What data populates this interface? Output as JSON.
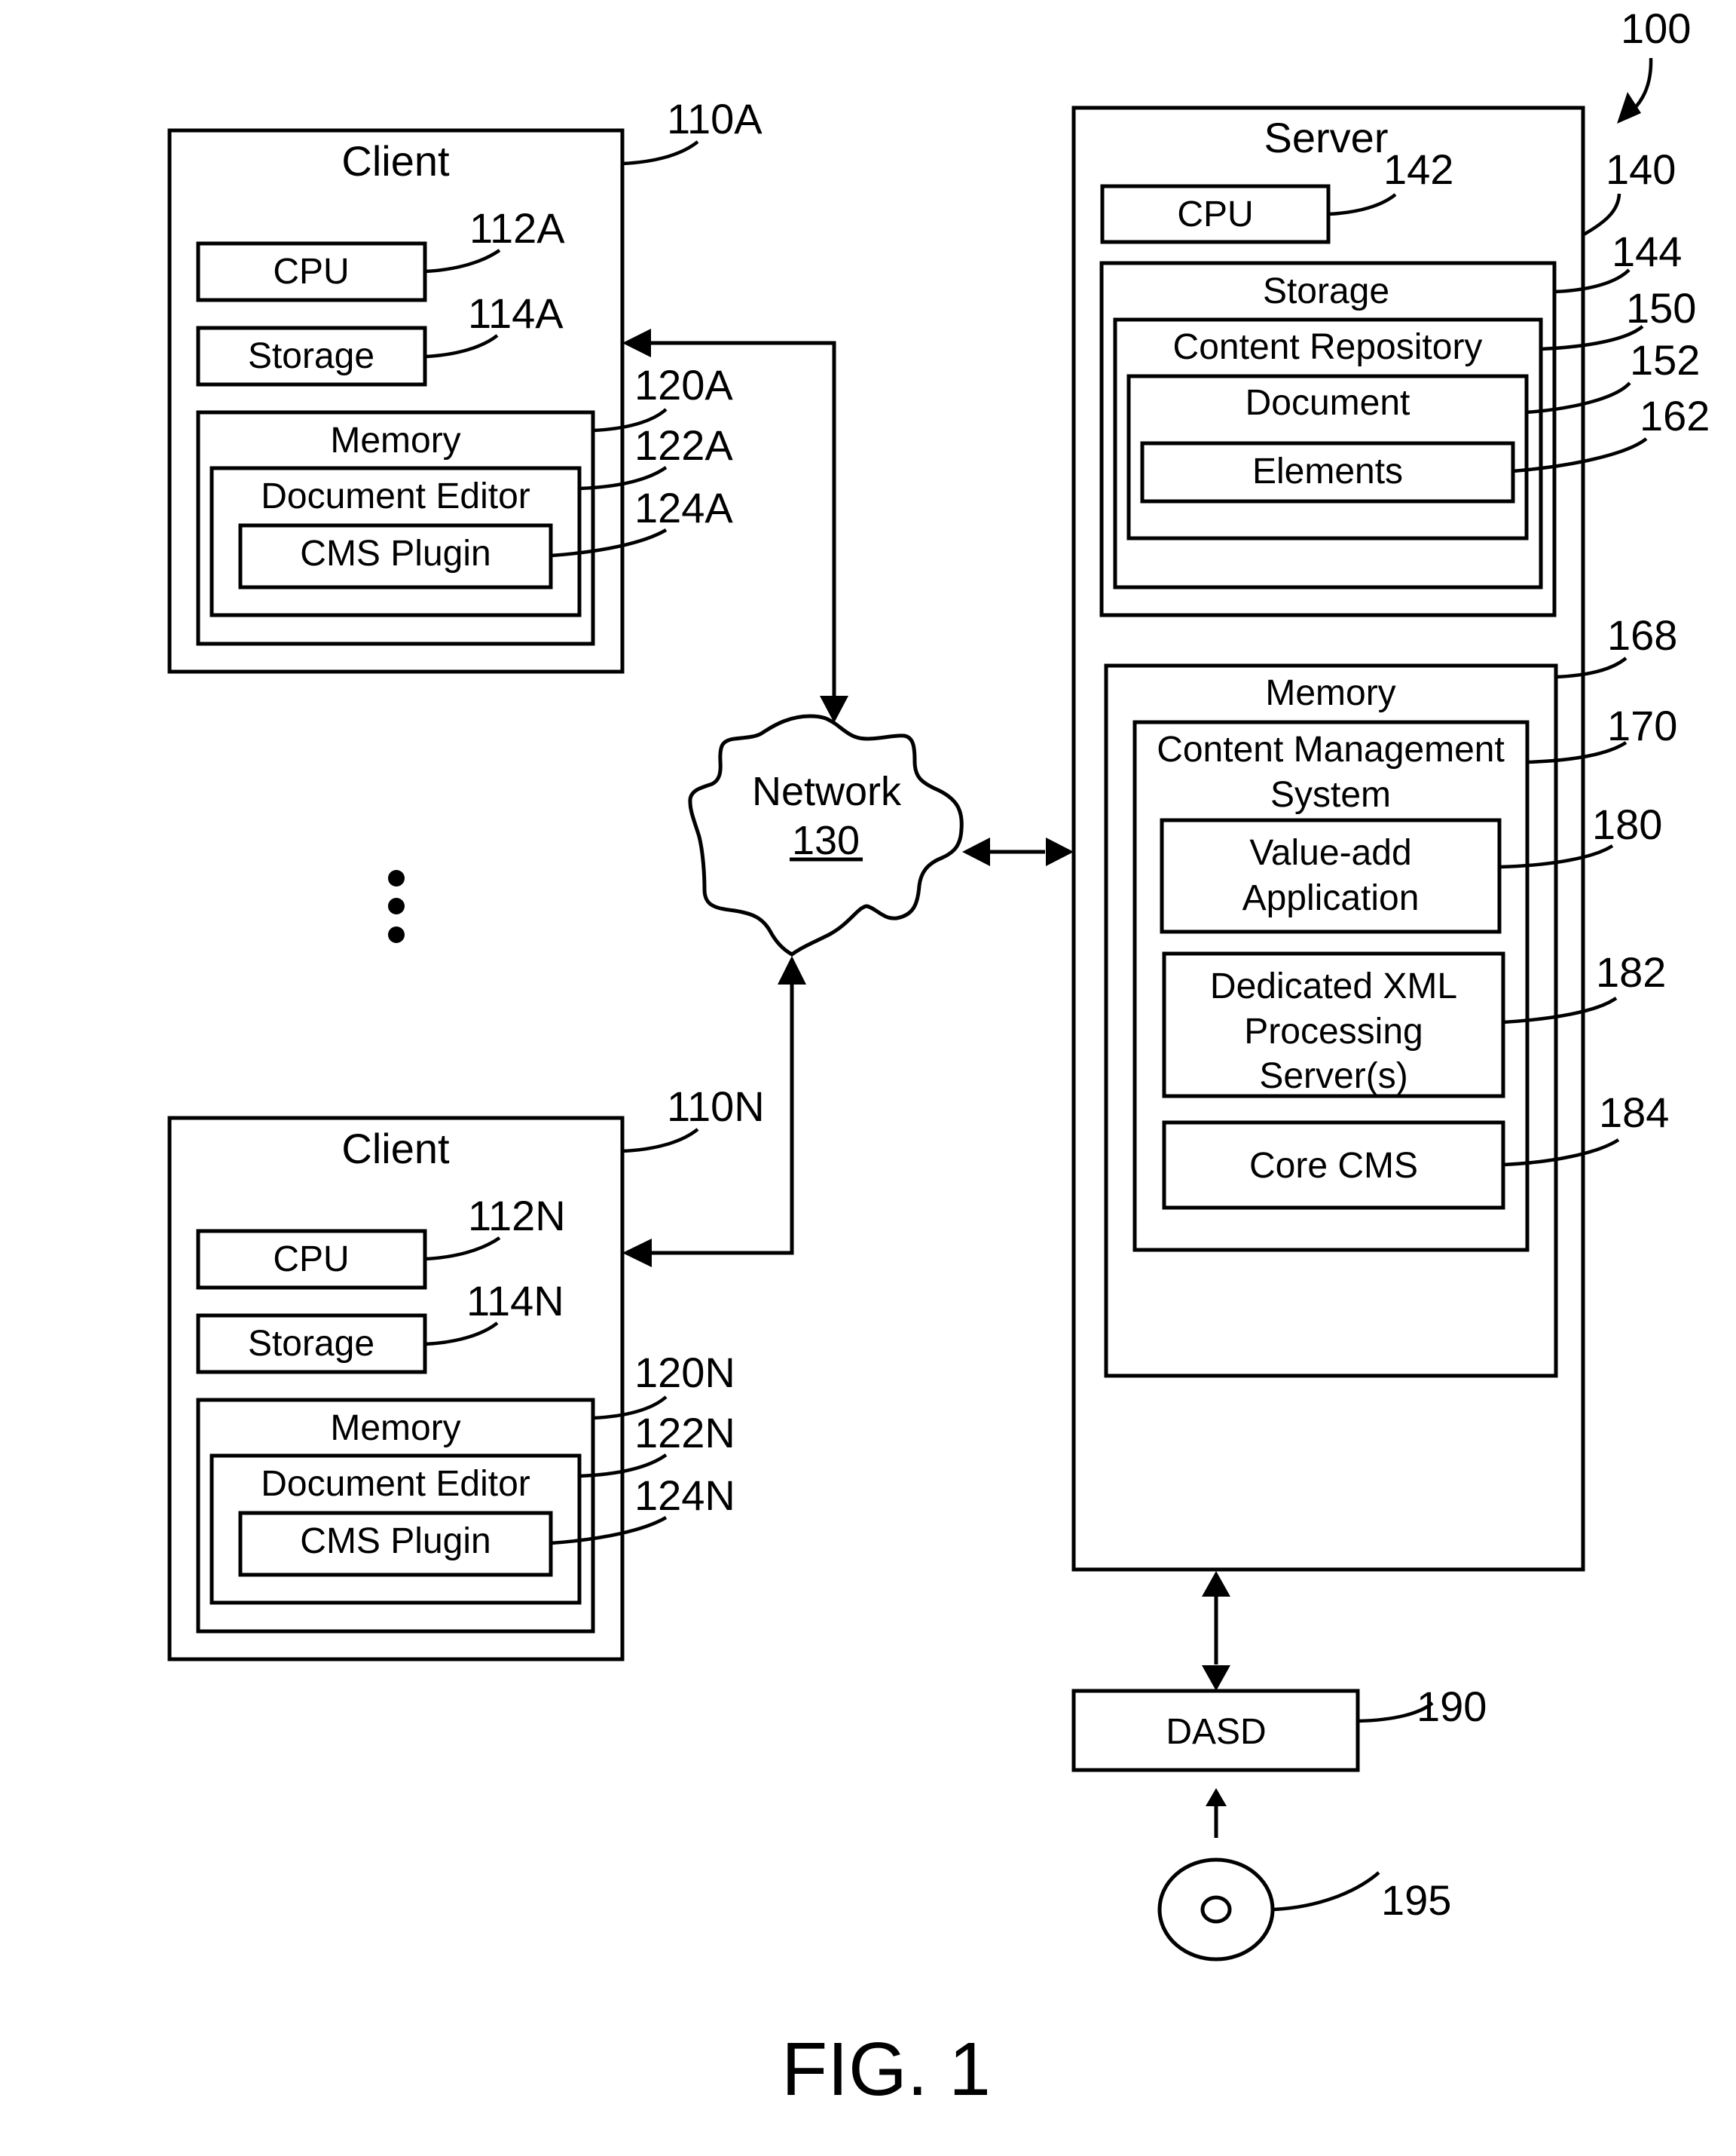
{
  "figure": {
    "caption": "FIG. 1",
    "system_ref": "100"
  },
  "clients": [
    {
      "ref": "110A",
      "title": "Client",
      "cpu": {
        "label": "CPU",
        "ref": "112A"
      },
      "storage": {
        "label": "Storage",
        "ref": "114A"
      },
      "memory": {
        "label": "Memory",
        "ref": "120A"
      },
      "document_editor": {
        "label": "Document Editor",
        "ref": "122A"
      },
      "cms_plugin": {
        "label": "CMS Plugin",
        "ref": "124A"
      }
    },
    {
      "ref": "110N",
      "title": "Client",
      "cpu": {
        "label": "CPU",
        "ref": "112N"
      },
      "storage": {
        "label": "Storage",
        "ref": "114N"
      },
      "memory": {
        "label": "Memory",
        "ref": "120N"
      },
      "document_editor": {
        "label": "Document Editor",
        "ref": "122N"
      },
      "cms_plugin": {
        "label": "CMS Plugin",
        "ref": "124N"
      }
    }
  ],
  "network": {
    "label": "Network",
    "ref": "130"
  },
  "server": {
    "ref": "140",
    "title": "Server",
    "cpu": {
      "label": "CPU",
      "ref": "142"
    },
    "storage": {
      "label": "Storage",
      "ref": "144"
    },
    "content_repository": {
      "label": "Content Repository",
      "ref": "150"
    },
    "document": {
      "label": "Document",
      "ref": "152"
    },
    "elements": {
      "label": "Elements",
      "ref": "162"
    },
    "memory": {
      "label": "Memory",
      "ref": "168"
    },
    "cms": {
      "label_line1": "Content Management",
      "label_line2": "System",
      "ref": "170"
    },
    "value_add": {
      "label_line1": "Value-add",
      "label_line2": "Application",
      "ref": "180"
    },
    "xml_servers": {
      "label_line1": "Dedicated XML",
      "label_line2": "Processing",
      "label_line3": "Server(s)",
      "ref": "182"
    },
    "core_cms": {
      "label": "Core CMS",
      "ref": "184"
    }
  },
  "dasd": {
    "label": "DASD",
    "ref": "190"
  },
  "media": {
    "ref": "195"
  },
  "ellipsis_icon": "vertical-ellipsis"
}
